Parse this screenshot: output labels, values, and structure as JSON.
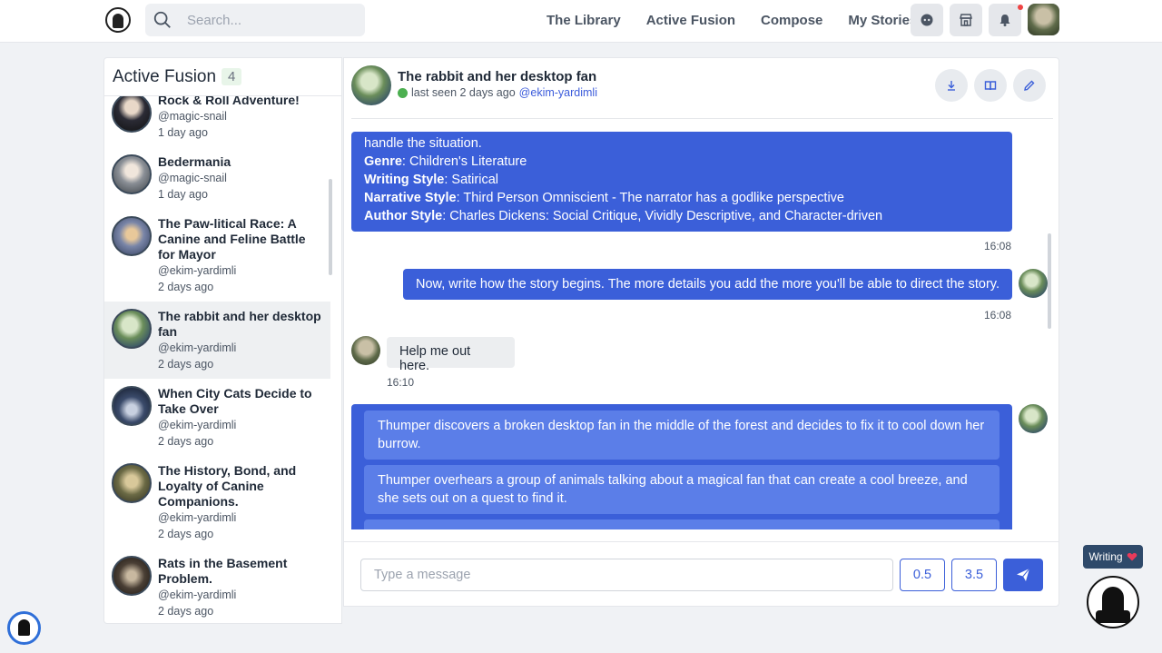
{
  "nav": {
    "search_placeholder": "Search...",
    "links": [
      "The Library",
      "Active Fusion",
      "Compose",
      "My Stories"
    ]
  },
  "sidebar": {
    "title": "Active Fusion",
    "count": "4",
    "stories": [
      {
        "title": "Rock & Roll Adventure!",
        "user": "@magic-snail",
        "time": "1 day ago",
        "avatar_color": "#2b2b35"
      },
      {
        "title": "Bedermania",
        "user": "@magic-snail",
        "time": "1 day ago",
        "avatar_color": "#8a8f96"
      },
      {
        "title": "The Paw-litical Race: A Canine and Feline Battle for Mayor",
        "user": "@ekim-yardimli",
        "time": "2 days ago",
        "avatar_color": "#7a86a8"
      },
      {
        "title": "The rabbit and her desktop fan",
        "user": "@ekim-yardimli",
        "time": "2 days ago",
        "avatar_color": "#6b8e5a",
        "active": true
      },
      {
        "title": "When City Cats Decide to Take Over",
        "user": "@ekim-yardimli",
        "time": "2 days ago",
        "avatar_color": "#1f2a3f"
      },
      {
        "title": "The History, Bond, and Loyalty of Canine Companions.",
        "user": "@ekim-yardimli",
        "time": "2 days ago",
        "avatar_color": "#6b6a45"
      },
      {
        "title": "Rats in the Basement Problem.",
        "user": "@ekim-yardimli",
        "time": "2 days ago",
        "avatar_color": "#4a3f35"
      }
    ]
  },
  "chat": {
    "title": "The rabbit and her desktop fan",
    "status": "last seen 2 days ago",
    "handle": "@ekim-yardimli",
    "prompt_block": {
      "intro": "handle the situation.",
      "lines": [
        {
          "label": "Genre",
          "value": ": Children's Literature"
        },
        {
          "label": "Writing Style",
          "value": ": Satirical"
        },
        {
          "label": "Narrative Style",
          "value": ": Third Person Omniscient - The narrator has a godlike perspective"
        },
        {
          "label": "Author Style",
          "value": ": Charles Dickens: Social Critique, Vividly Descriptive, and Character-driven"
        }
      ],
      "time": "16:08"
    },
    "bot_message": {
      "text": "Now, write how the story begins. The more details you add the more you'll be able to direct the story.",
      "time": "16:08"
    },
    "user_message": {
      "text": "Help me out here.",
      "time": "16:10"
    },
    "options": [
      "Thumper discovers a broken desktop fan in the middle of the forest and decides to fix it to cool down her burrow.",
      "Thumper overhears a group of animals talking about a magical fan that can create a cool breeze, and she sets out on a quest to find it."
    ]
  },
  "composer": {
    "placeholder": "Type a message",
    "value_a": "0.5",
    "value_b": "3.5"
  },
  "badge": {
    "label": "Writing"
  },
  "colors": {
    "accent": "#3b5fd9",
    "online": "#4caf50",
    "notification": "#ef4444"
  }
}
